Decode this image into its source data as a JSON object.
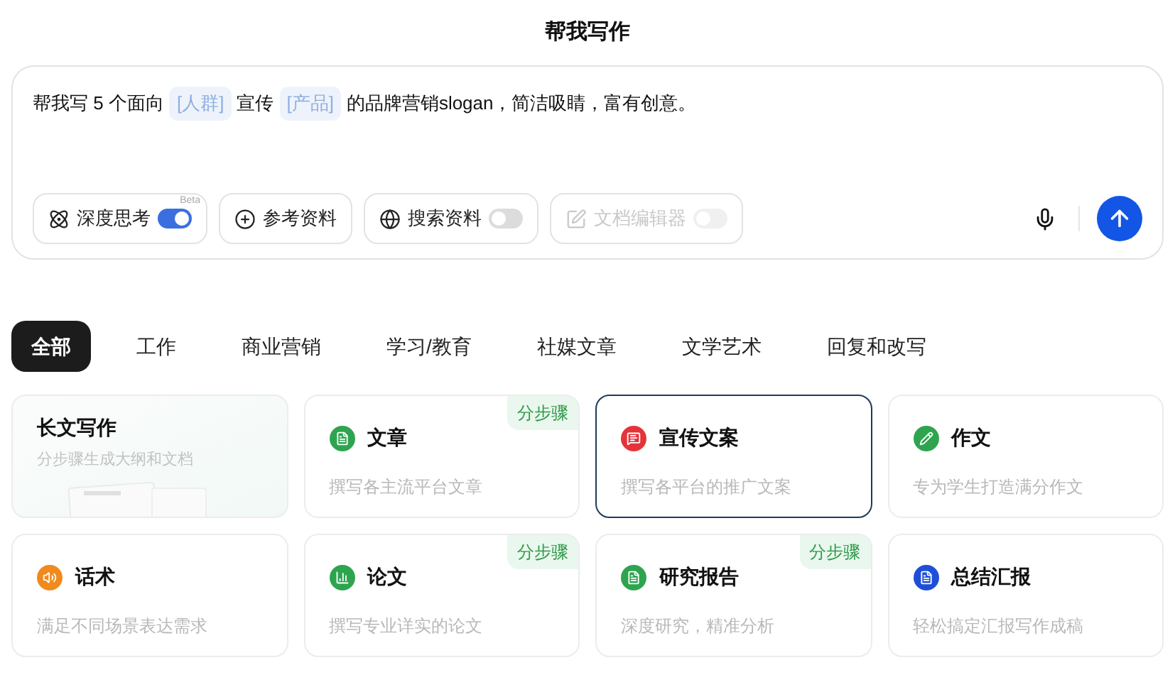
{
  "title": "帮我写作",
  "prompt": {
    "parts": [
      {
        "kind": "text",
        "text": "帮我写 5 个面向"
      },
      {
        "kind": "slot",
        "text": "[人群]"
      },
      {
        "kind": "text",
        "text": "宣传"
      },
      {
        "kind": "slot",
        "text": "[产品]"
      },
      {
        "kind": "text",
        "text": "的品牌营销slogan，简洁吸睛，富有创意。"
      }
    ]
  },
  "tools": [
    {
      "kind": "toggle",
      "label": "深度思考",
      "on": true,
      "disabled": false,
      "badge": "Beta"
    },
    {
      "kind": "plain",
      "label": "参考资料",
      "disabled": false
    },
    {
      "kind": "toggle",
      "label": "搜索资料",
      "on": false,
      "disabled": false
    },
    {
      "kind": "toggle",
      "label": "文档编辑器",
      "on": false,
      "disabled": true
    }
  ],
  "tabs": [
    {
      "label": "全部",
      "selected": true
    },
    {
      "label": "工作",
      "selected": false
    },
    {
      "label": "商业营销",
      "selected": false
    },
    {
      "label": "学习/教育",
      "selected": false
    },
    {
      "label": "社媒文章",
      "selected": false
    },
    {
      "label": "文学艺术",
      "selected": false
    },
    {
      "label": "回复和改写",
      "selected": false
    }
  ],
  "cards": [
    {
      "kind": "feature",
      "title": "长文写作",
      "subtitle": "分步骤生成大纲和文档",
      "selected": false
    },
    {
      "kind": "normal",
      "color": "#2ea44f",
      "title": "文章",
      "subtitle": "撰写各主流平台文章",
      "badge": "分步骤",
      "selected": false
    },
    {
      "kind": "normal",
      "color": "#e5333a",
      "title": "宣传文案",
      "subtitle": "撰写各平台的推广文案",
      "selected": true
    },
    {
      "kind": "normal",
      "color": "#2ea44f",
      "title": "作文",
      "subtitle": "专为学生打造满分作文",
      "selected": false
    },
    {
      "kind": "normal",
      "color": "#f08a1c",
      "title": "话术",
      "subtitle": "满足不同场景表达需求",
      "selected": false
    },
    {
      "kind": "normal",
      "color": "#2ea44f",
      "title": "论文",
      "subtitle": "撰写专业详实的论文",
      "badge": "分步骤",
      "selected": false
    },
    {
      "kind": "normal",
      "color": "#2ea44f",
      "title": "研究报告",
      "subtitle": "深度研究，精准分析",
      "badge": "分步骤",
      "selected": false
    },
    {
      "kind": "normal",
      "color": "#1f4fd8",
      "title": "总结汇报",
      "subtitle": "轻松搞定汇报写作成稿",
      "selected": false
    }
  ]
}
